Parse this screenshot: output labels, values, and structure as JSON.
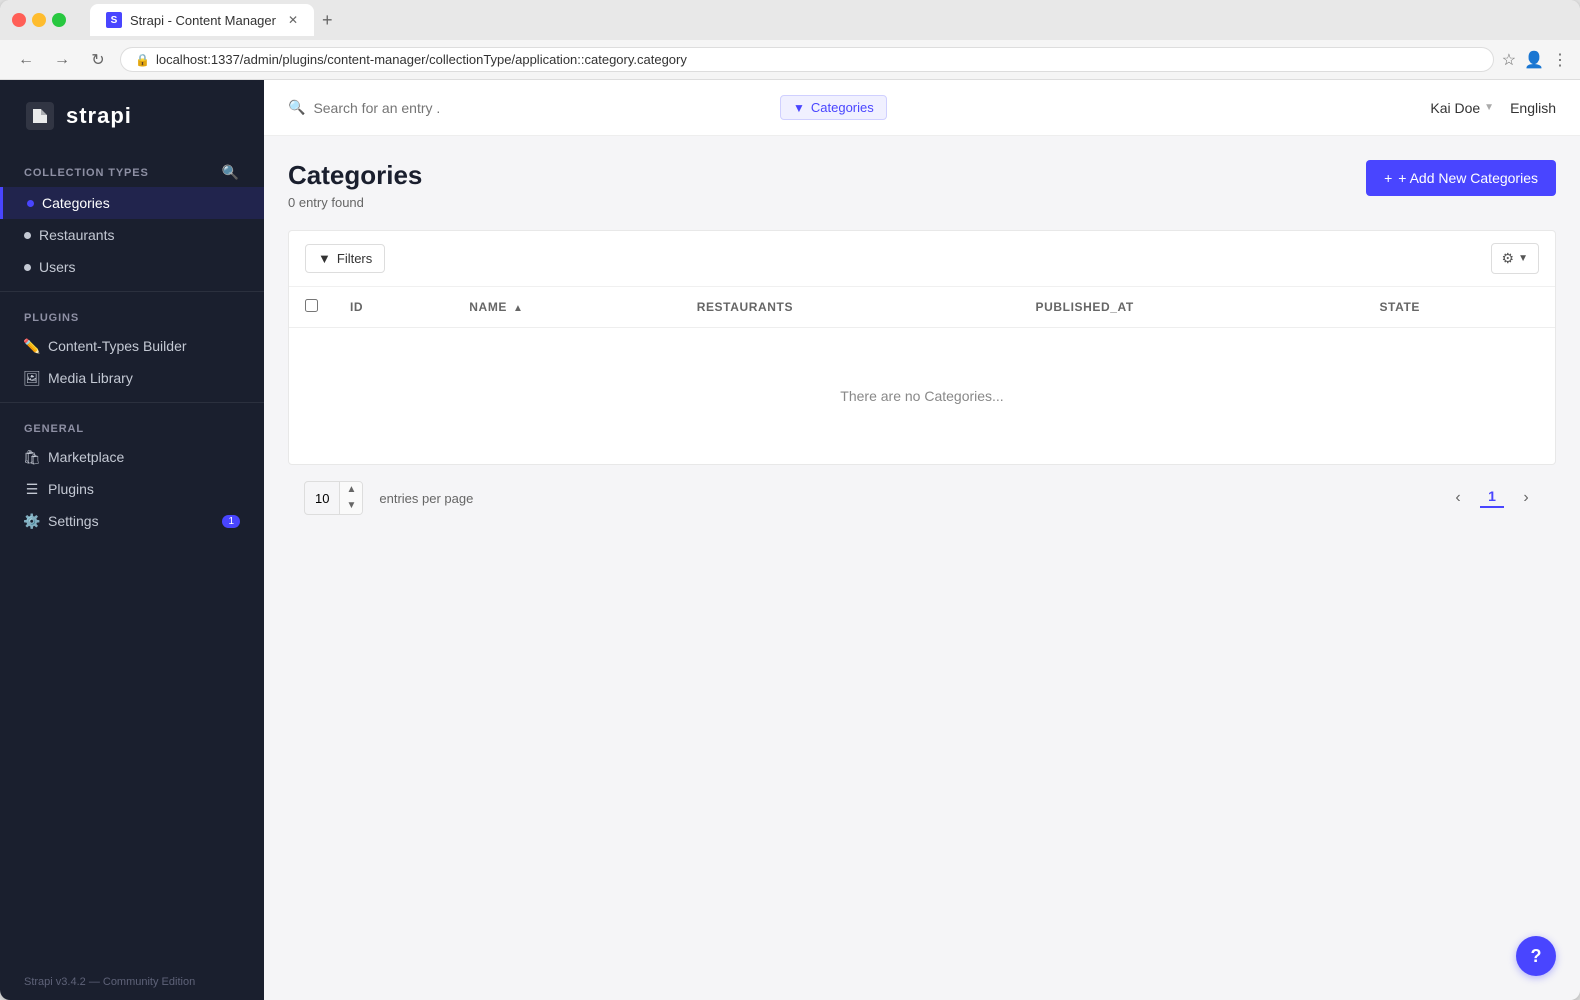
{
  "browser": {
    "tab_title": "Strapi - Content Manager",
    "url": "localhost:1337/admin/plugins/content-manager/collectionType/application::category.category",
    "tab_favicon": "S"
  },
  "sidebar": {
    "logo_text": "strapi",
    "collection_types_title": "COLLECTION TYPES",
    "items": [
      {
        "id": "categories",
        "label": "Categories",
        "active": true
      },
      {
        "id": "restaurants",
        "label": "Restaurants",
        "active": false
      },
      {
        "id": "users",
        "label": "Users",
        "active": false
      }
    ],
    "plugins_title": "PLUGINS",
    "plugin_items": [
      {
        "id": "content-types-builder",
        "label": "Content-Types Builder",
        "icon": "pencil"
      },
      {
        "id": "media-library",
        "label": "Media Library",
        "icon": "image"
      }
    ],
    "general_title": "GENERAL",
    "general_items": [
      {
        "id": "marketplace",
        "label": "Marketplace",
        "icon": "shop"
      },
      {
        "id": "plugins",
        "label": "Plugins",
        "icon": "list"
      },
      {
        "id": "settings",
        "label": "Settings",
        "icon": "gear",
        "badge": "1"
      }
    ],
    "footer": "Strapi v3.4.2 — Community Edition"
  },
  "topbar": {
    "search_placeholder": "Search for an entry .",
    "filter_label": "Categories",
    "user_name": "Kai Doe",
    "language": "English"
  },
  "page": {
    "title": "Categories",
    "entry_count": "0 entry found",
    "add_button": "+ Add New Categories"
  },
  "table": {
    "filters_label": "Filters",
    "columns": [
      {
        "id": "id",
        "label": "Id",
        "sortable": false
      },
      {
        "id": "name",
        "label": "Name",
        "sortable": true
      },
      {
        "id": "restaurants",
        "label": "Restaurants",
        "sortable": false
      },
      {
        "id": "published_at",
        "label": "Published_at",
        "sortable": false
      },
      {
        "id": "state",
        "label": "State",
        "sortable": false
      }
    ],
    "empty_message": "There are no Categories..."
  },
  "pagination": {
    "per_page_value": "10",
    "per_page_label": "entries per page",
    "current_page": "1"
  },
  "help_button": "?"
}
